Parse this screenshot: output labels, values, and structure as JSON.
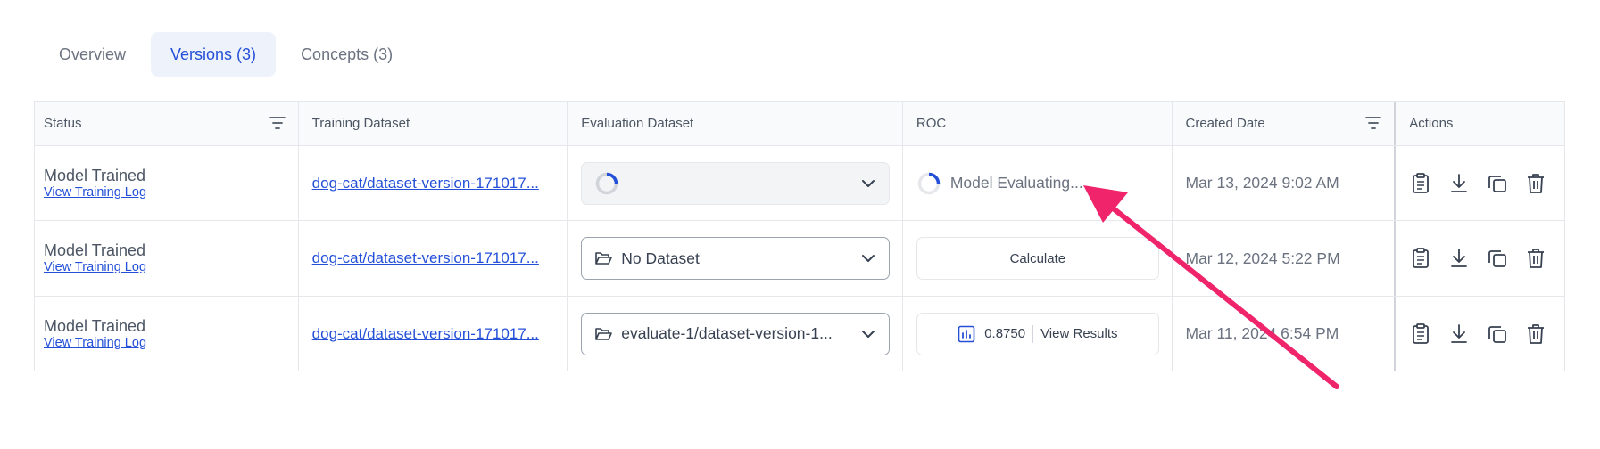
{
  "tabs": [
    {
      "label": "Overview",
      "active": false
    },
    {
      "label": "Versions (3)",
      "active": true
    },
    {
      "label": "Concepts (3)",
      "active": false
    }
  ],
  "columns": {
    "status": "Status",
    "training": "Training Dataset",
    "evaluation": "Evaluation Dataset",
    "roc": "ROC",
    "created": "Created Date",
    "actions": "Actions"
  },
  "rows": [
    {
      "status": "Model Trained",
      "log_link": "View Training Log",
      "training_dataset": "dog-cat/dataset-version-171017...",
      "evaluation_dataset": "",
      "roc_state": "Model Evaluating...",
      "created": "Mar 13, 2024 9:02 AM"
    },
    {
      "status": "Model Trained",
      "log_link": "View Training Log",
      "training_dataset": "dog-cat/dataset-version-171017...",
      "evaluation_dataset": "No Dataset",
      "roc_button": "Calculate",
      "created": "Mar 12, 2024 5:22 PM"
    },
    {
      "status": "Model Trained",
      "log_link": "View Training Log",
      "training_dataset": "dog-cat/dataset-version-171017...",
      "evaluation_dataset": "evaluate-1/dataset-version-1...",
      "roc_score": "0.8750",
      "roc_results": "View Results",
      "created": "Mar 11, 2024 6:54 PM"
    }
  ],
  "colors": {
    "accent": "#2450d8",
    "annotation_arrow": "#f0246a"
  },
  "icons": {
    "actions": [
      "clipboard-icon",
      "download-icon",
      "copy-icon",
      "trash-icon"
    ],
    "filter": "filter-icon",
    "dataset": "folder-open-icon",
    "chart": "bar-chart-icon"
  }
}
